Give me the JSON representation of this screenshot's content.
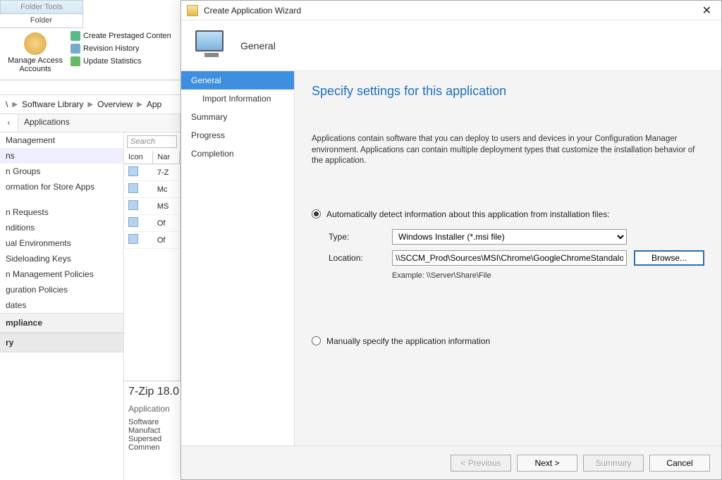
{
  "ribbon": {
    "tab1": "Folder Tools",
    "tab2": "Folder",
    "bigLabel": "Manage Access\nAccounts",
    "items": [
      "Create Prestaged Conten",
      "Revision History",
      "Update Statistics"
    ]
  },
  "breadcrumbs": [
    "\\",
    "Software Library",
    "Overview",
    "App"
  ],
  "midHeader": "Applications",
  "searchPlaceholder": "Search",
  "nav": {
    "items1": [
      "Management",
      "ns",
      "n Groups",
      "ormation for Store Apps"
    ],
    "items2": [
      "n Requests",
      "nditions",
      "ual Environments",
      "Sideloading Keys",
      "n Management Policies",
      "guration Policies",
      "dates"
    ],
    "section1": "mpliance",
    "section2": "ry"
  },
  "table": {
    "cols": [
      "Icon",
      "Nar"
    ],
    "rows": [
      "7-Z",
      "Mc",
      "MS",
      "Of",
      "Of"
    ]
  },
  "detail": {
    "title": "7-Zip 18.0",
    "sub": "Application",
    "rows": [
      "Software",
      "Manufact",
      "Supersed",
      "Commen"
    ]
  },
  "wizard": {
    "title": "Create Application Wizard",
    "headerLabel": "General",
    "steps": [
      "General",
      "Import Information",
      "Summary",
      "Progress",
      "Completion"
    ],
    "heading": "Specify settings for this application",
    "desc": "Applications contain software that you can deploy to users and devices in your Configuration Manager environment. Applications can contain multiple deployment types that customize the installation behavior of the application.",
    "radio1": "Automatically detect information about this application from installation files:",
    "typeLabel": "Type:",
    "typeValue": "Windows Installer (*.msi file)",
    "locationLabel": "Location:",
    "locationValue": "\\\\SCCM_Prod\\Sources\\MSI\\Chrome\\GoogleChromeStandaloneEnterpri",
    "browse": "Browse...",
    "example": "Example: \\\\Server\\Share\\File",
    "radio2": "Manually specify the application information",
    "buttons": {
      "prev": "< Previous",
      "next": "Next >",
      "summary": "Summary",
      "cancel": "Cancel"
    }
  }
}
